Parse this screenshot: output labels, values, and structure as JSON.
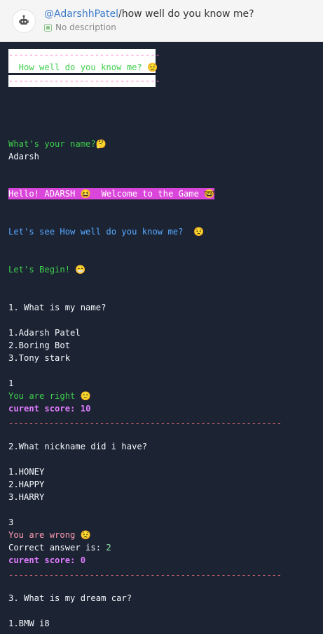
{
  "header": {
    "username": "@AdarshhPatel",
    "separator": "/",
    "repl_name": "how well do you know me?",
    "description": "No description"
  },
  "console": {
    "banner_dashes": "------------------------------",
    "banner_title": "  How well do you know me? 😟",
    "q_name_prompt": "What's your name?🤔",
    "q_name_answer": "Adarsh",
    "hello_line": "Hello! ADARSH 😆  Welcome to the Game 🤓",
    "lets_see": "Let's see How well do you know me?  😟",
    "lets_begin": "Let's Begin! 😁",
    "q1": "1. What is my name?",
    "q1_opts": [
      "1.Adarsh Patel",
      "2.Boring Bot",
      "3.Tony stark"
    ],
    "q1_input": "1",
    "q1_result": "You are right 🙂",
    "score_label": "curent score: ",
    "q1_score": "10",
    "separator_line": "------------------------------------------------------",
    "q2": "2.What nickname did i have?",
    "q2_opts": [
      "1.HONEY",
      "2.HAPPY",
      "3.HARRY"
    ],
    "q2_input": "3",
    "q2_result": "You are wrong 😟",
    "correct_label": "Correct answer is: ",
    "q2_correct": "2",
    "q2_score": "0",
    "q3": "3. What is my dream car?",
    "q3_opt1": "1.BMW i8"
  }
}
